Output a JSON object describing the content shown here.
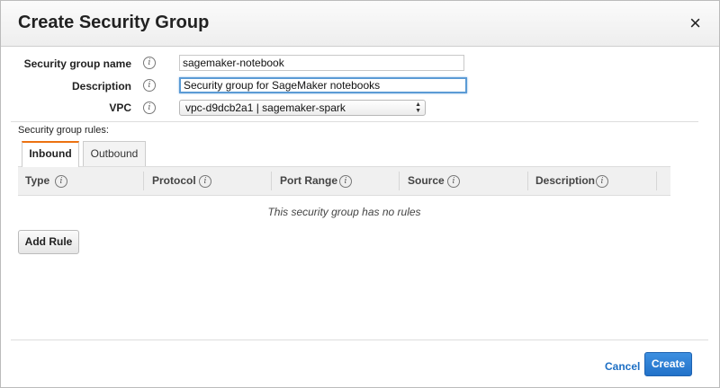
{
  "dialog": {
    "title": "Create Security Group",
    "close_glyph": "×"
  },
  "form": {
    "name": {
      "label": "Security group name",
      "value": "sagemaker-notebook"
    },
    "description": {
      "label": "Description",
      "value": "Security group for SageMaker notebooks"
    },
    "vpc": {
      "label": "VPC",
      "value": "vpc-d9dcb2a1 | sagemaker-spark"
    }
  },
  "info_glyph": "i",
  "icons": {
    "info": "info-icon",
    "close": "close-icon",
    "select_arrows": "up-down-arrows-icon"
  },
  "rules": {
    "caption": "Security group rules:",
    "tabs": [
      {
        "label": "Inbound",
        "active": true
      },
      {
        "label": "Outbound",
        "active": false
      }
    ],
    "columns": [
      "Type",
      "Protocol",
      "Port Range",
      "Source",
      "Description"
    ],
    "empty_message": "This security group has no rules",
    "add_rule_label": "Add Rule"
  },
  "footer": {
    "cancel_label": "Cancel",
    "create_label": "Create"
  },
  "colors": {
    "accent_tab": "#ec7211",
    "primary_button": "#2272c9",
    "link": "#1d6fc4"
  }
}
